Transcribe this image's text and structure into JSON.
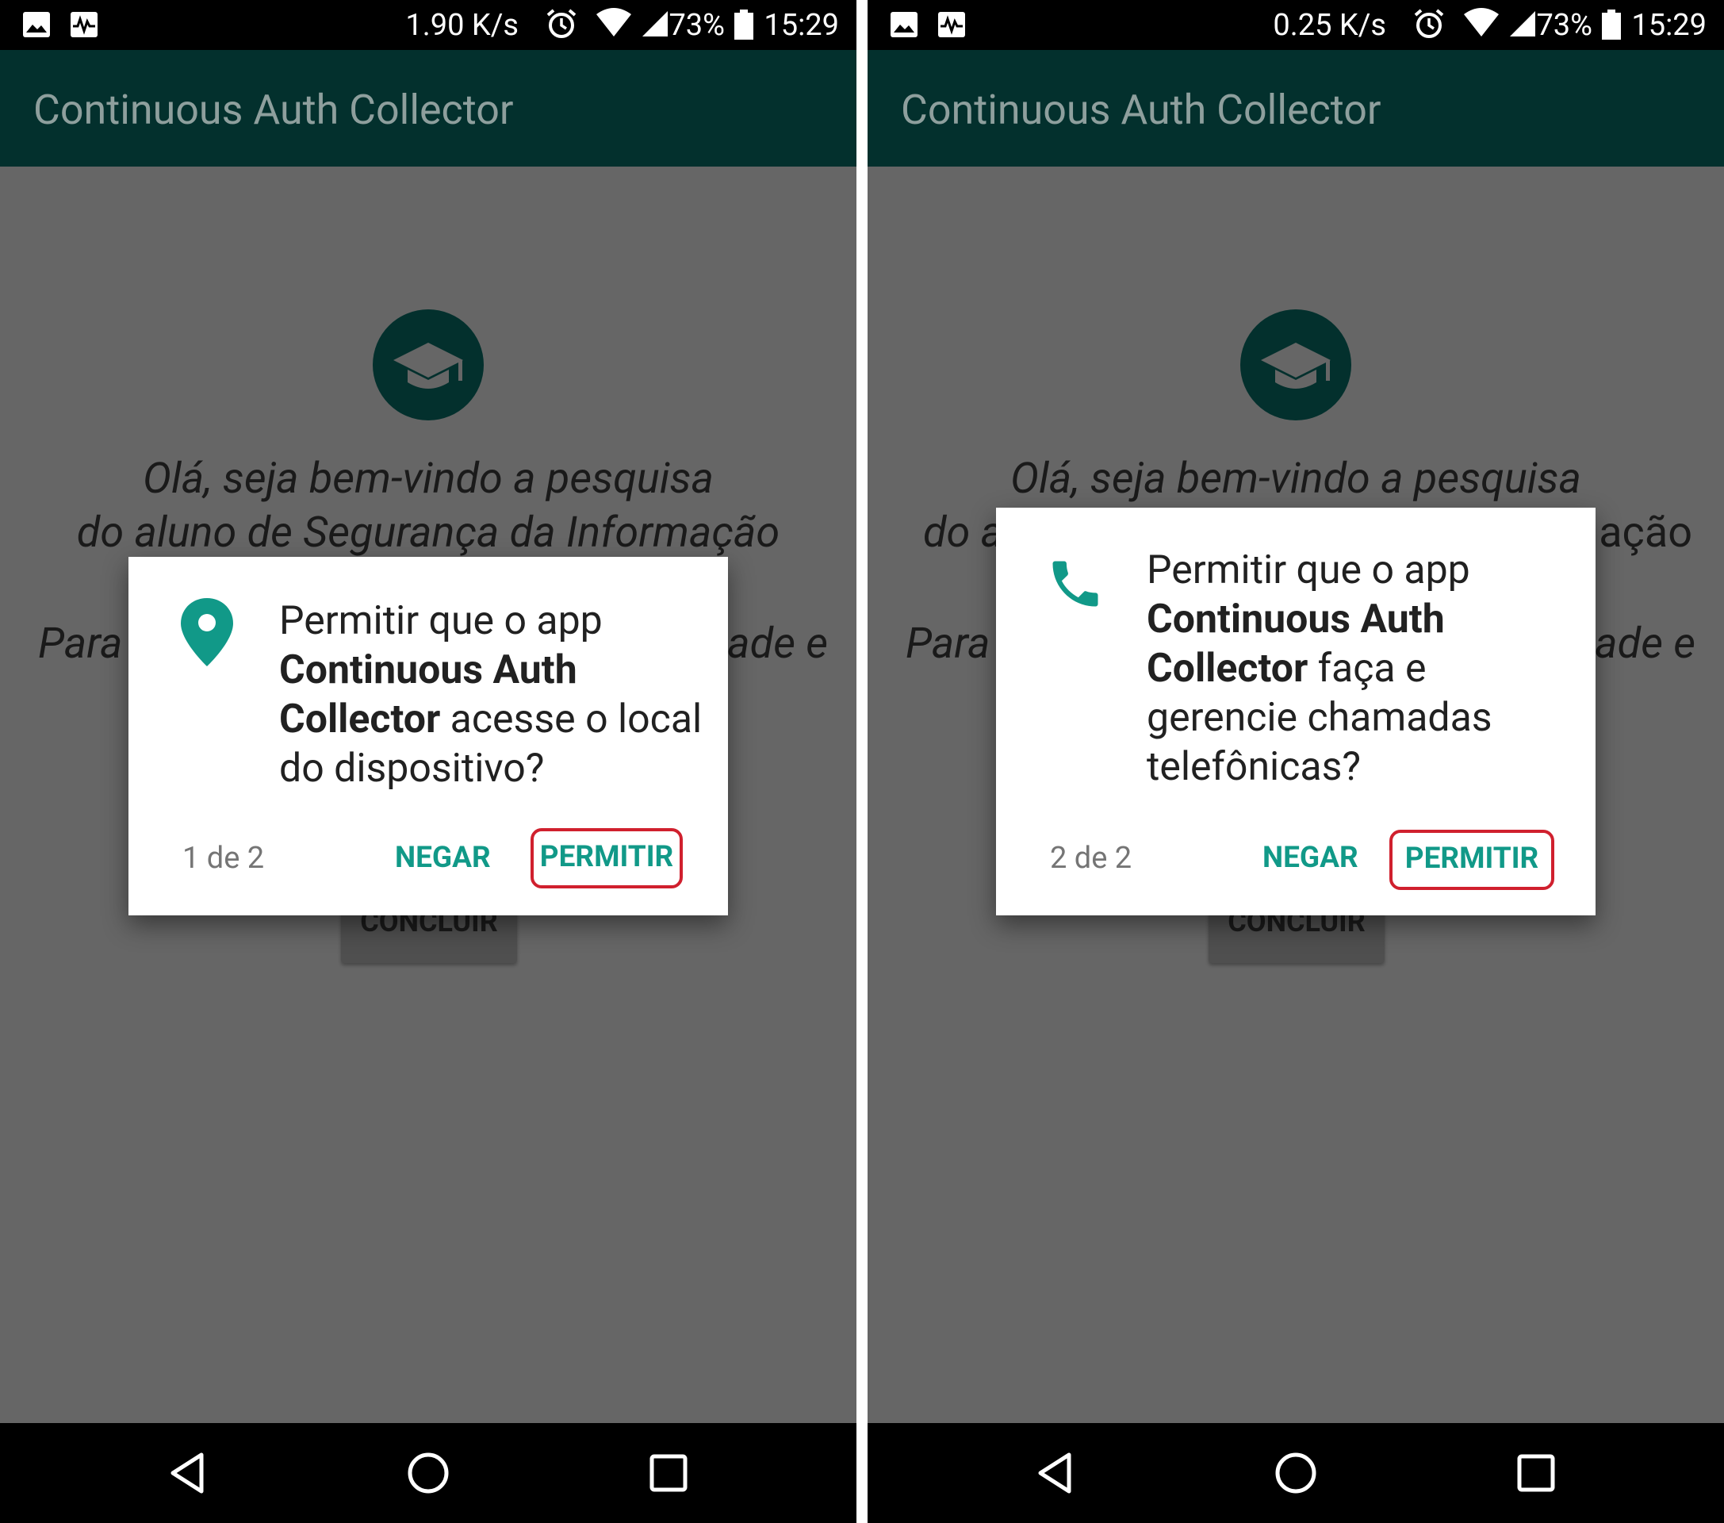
{
  "panels": [
    {
      "status": {
        "speed": "1.90 K/s",
        "battery": "73%",
        "time": "15:29"
      },
      "app_title": "Continuous Auth Collector",
      "welcome_line1": "Olá, seja bem-vindo a pesquisa",
      "welcome_line2": "do aluno de Segurança da Informação",
      "para_left": "Para",
      "para_right": "ade e",
      "concluir_label": "CONCLUIR",
      "dialog": {
        "icon": "location-pin-icon",
        "message_prefix": "Permitir que o app ",
        "message_app": "Continuous Auth Collector",
        "message_suffix": " acesse o local do dispositivo?",
        "counter": "1 de 2",
        "deny_label": "NEGAR",
        "allow_label": "PERMITIR"
      }
    },
    {
      "status": {
        "speed": "0.25 K/s",
        "battery": "73%",
        "time": "15:29"
      },
      "app_title": "Continuous Auth Collector",
      "welcome_line1": "Olá, seja bem-vindo a pesquisa",
      "welcome_line2_left": "do a",
      "welcome_line2_right": "ação",
      "para_left": "Para",
      "para_right": "ade e",
      "concluir_label": "CONCLUIR",
      "dialog": {
        "icon": "phone-icon",
        "message_prefix": "Permitir que o app ",
        "message_app": "Continuous Auth Collector",
        "message_suffix": " faça e gerencie chamadas telefônicas?",
        "counter": "2 de 2",
        "deny_label": "NEGAR",
        "allow_label": "PERMITIR"
      }
    }
  ],
  "colors": {
    "appbar": "#03302d",
    "scrim_background": "#666666",
    "accent": "#119988",
    "highlight_border": "#d0202e"
  }
}
